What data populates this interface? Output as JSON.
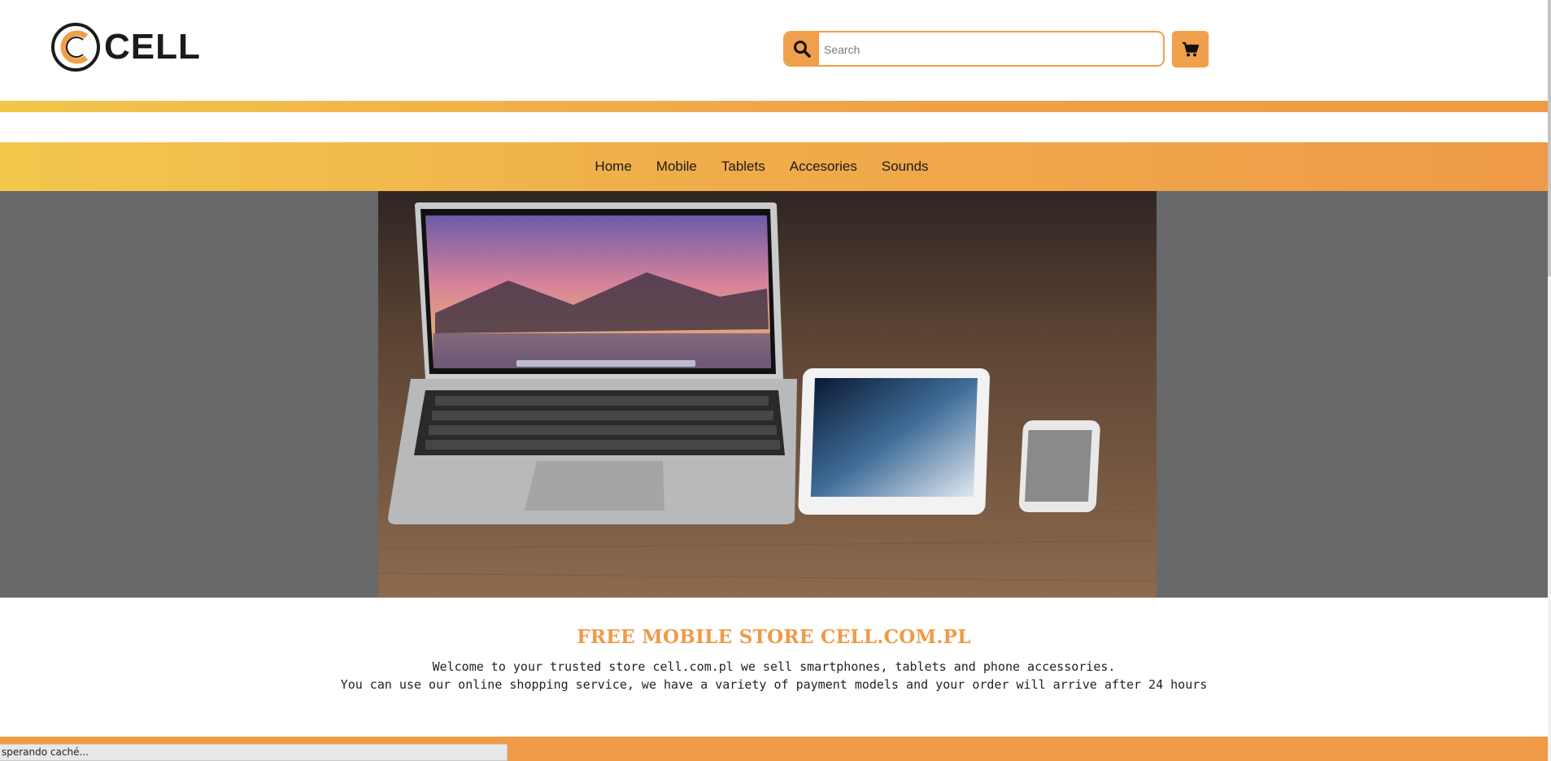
{
  "brand": {
    "name": "CELL",
    "accent": "#f0a04b",
    "accent_yellow": "#f2c84c",
    "title_color": "#ef9a46"
  },
  "search": {
    "placeholder": "Search",
    "value": "",
    "icon": "search-icon"
  },
  "cart": {
    "icon": "shopping-cart-icon"
  },
  "nav": {
    "items": [
      "Home",
      "Mobile",
      "Tablets",
      "Accesories",
      "Sounds"
    ]
  },
  "hero": {
    "image": "laptop-tablet-phone-on-wooden-desk"
  },
  "intro": {
    "title": "FREE MOBILE STORE CELL.COM.PL",
    "line1": "Welcome to your trusted store cell.com.pl we sell smartphones, tablets and phone accessories.",
    "line2": "You can use our online shopping service, we have a variety of payment models and your order will arrive after 24 hours"
  },
  "status_bar": {
    "text": "sperando caché..."
  }
}
